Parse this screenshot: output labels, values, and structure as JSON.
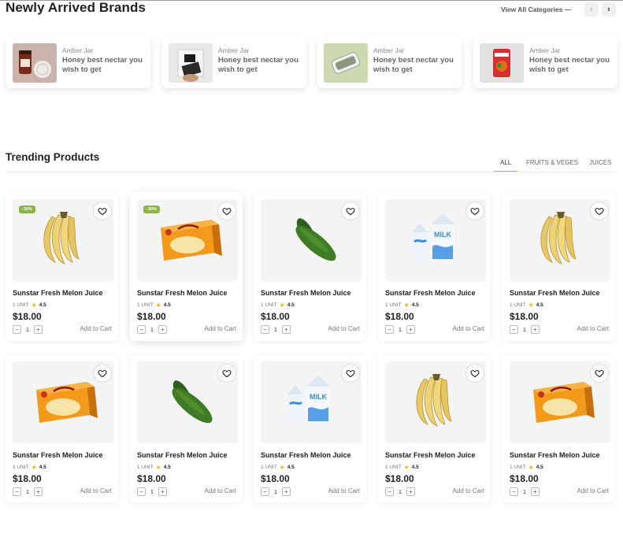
{
  "brands_section": {
    "title": "Newly Arrived Brands",
    "view_all": "View All Categories —",
    "prev_icon": "‹",
    "next_icon": "›",
    "cards": [
      {
        "sub": "Amber Jar",
        "text": "Honey best nectar you wish to get",
        "thumb": "jar"
      },
      {
        "sub": "Amber Jar",
        "text": "Honey best nectar you wish to get",
        "thumb": "pouch"
      },
      {
        "sub": "Amber Jar",
        "text": "Honey best nectar you wish to get",
        "thumb": "tin"
      },
      {
        "sub": "Amber Jar",
        "text": "Honey best nectar you wish to get",
        "thumb": "food-bag"
      }
    ]
  },
  "trending": {
    "title": "Trending Products",
    "tabs": [
      "ALL",
      "FRUITS & VEGES",
      "JUICES"
    ],
    "active_tab": "ALL",
    "add_to_cart": "Add to Cart",
    "products": [
      {
        "name": "Sunstar Fresh Melon Juice",
        "unit": "1 UNIT",
        "rating": "4.5",
        "price": "$18.00",
        "qty": "1",
        "badge": "-30%",
        "image": "banana"
      },
      {
        "name": "Sunstar Fresh Melon Juice",
        "unit": "1 UNIT",
        "rating": "4.5",
        "price": "$18.00",
        "qty": "1",
        "badge": "-30%",
        "image": "box"
      },
      {
        "name": "Sunstar Fresh Melon Juice",
        "unit": "1 UNIT",
        "rating": "4.5",
        "price": "$18.00",
        "qty": "1",
        "badge": "",
        "image": "cucumber"
      },
      {
        "name": "Sunstar Fresh Melon Juice",
        "unit": "1 UNIT",
        "rating": "4.5",
        "price": "$18.00",
        "qty": "1",
        "badge": "",
        "image": "milk"
      },
      {
        "name": "Sunstar Fresh Melon Juice",
        "unit": "1 UNIT",
        "rating": "4.5",
        "price": "$18.00",
        "qty": "1",
        "badge": "",
        "image": "banana"
      },
      {
        "name": "Sunstar Fresh Melon Juice",
        "unit": "1 UNIT",
        "rating": "4.5",
        "price": "$18.00",
        "qty": "1",
        "badge": "",
        "image": "box"
      },
      {
        "name": "Sunstar Fresh Melon Juice",
        "unit": "1 UNIT",
        "rating": "4.5",
        "price": "$18.00",
        "qty": "1",
        "badge": "",
        "image": "cucumber"
      },
      {
        "name": "Sunstar Fresh Melon Juice",
        "unit": "1 UNIT",
        "rating": "4.5",
        "price": "$18.00",
        "qty": "1",
        "badge": "",
        "image": "milk"
      },
      {
        "name": "Sunstar Fresh Melon Juice",
        "unit": "1 UNIT",
        "rating": "4.5",
        "price": "$18.00",
        "qty": "1",
        "badge": "",
        "image": "banana"
      },
      {
        "name": "Sunstar Fresh Melon Juice",
        "unit": "1 UNIT",
        "rating": "4.5",
        "price": "$18.00",
        "qty": "1",
        "badge": "",
        "image": "box"
      }
    ]
  },
  "colors": {
    "accent": "#f59f00",
    "badge": "#8bb445",
    "star": "#f2b01e"
  }
}
